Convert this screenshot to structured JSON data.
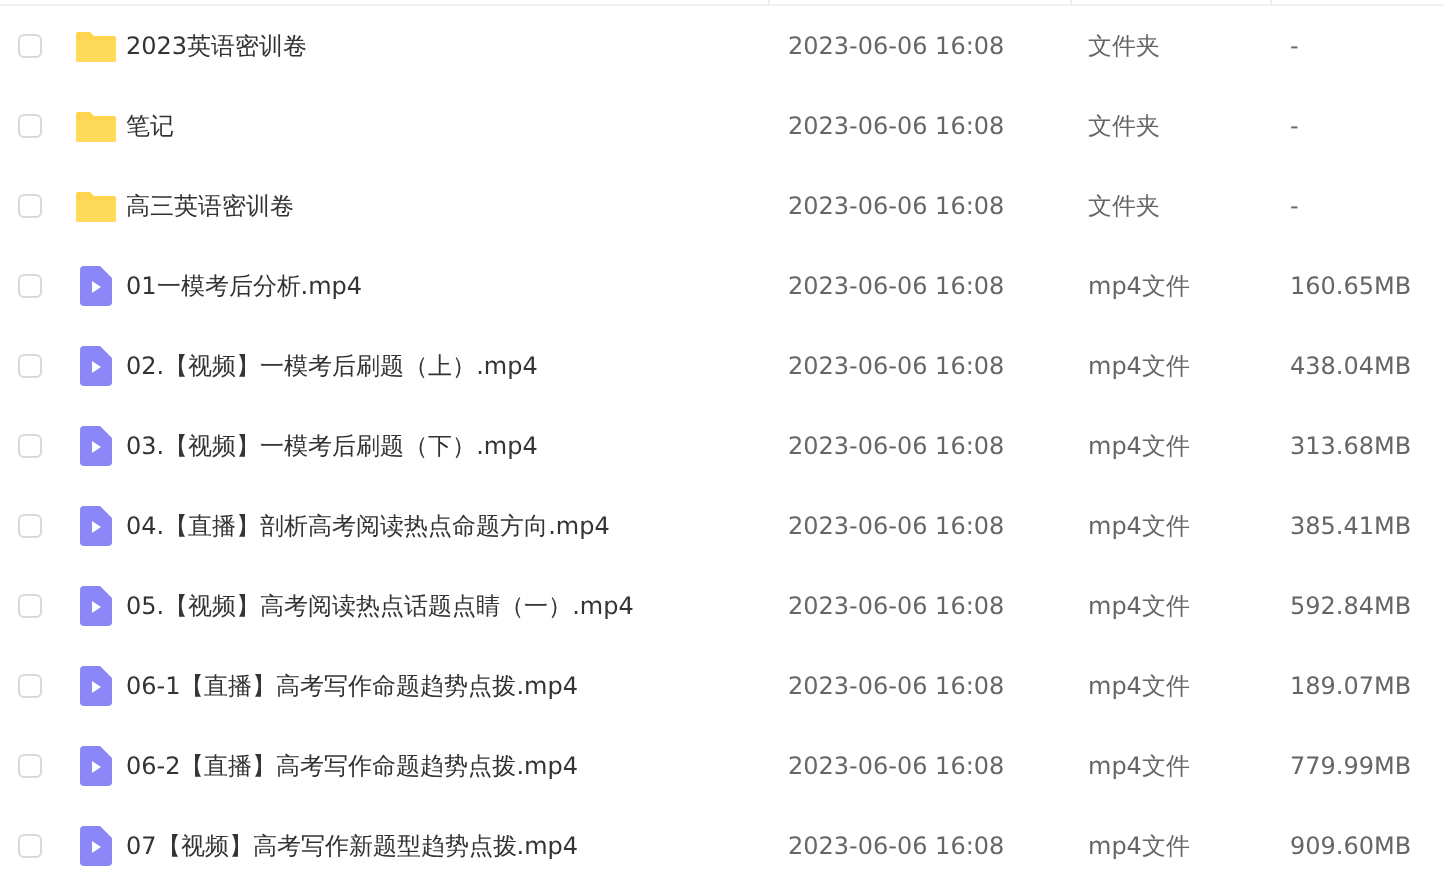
{
  "files": [
    {
      "kind": "folder",
      "name": "2023英语密训卷",
      "modified": "2023-06-06 16:08",
      "type": "文件夹",
      "size": "-",
      "checked": false
    },
    {
      "kind": "folder",
      "name": "笔记",
      "modified": "2023-06-06 16:08",
      "type": "文件夹",
      "size": "-",
      "checked": false
    },
    {
      "kind": "folder",
      "name": "高三英语密训卷",
      "modified": "2023-06-06 16:08",
      "type": "文件夹",
      "size": "-",
      "checked": false
    },
    {
      "kind": "video",
      "name": "01一模考后分析.mp4",
      "modified": "2023-06-06 16:08",
      "type": "mp4文件",
      "size": "160.65MB",
      "checked": false
    },
    {
      "kind": "video",
      "name": "02.【视频】一模考后刷题（上）.mp4",
      "modified": "2023-06-06 16:08",
      "type": "mp4文件",
      "size": "438.04MB",
      "checked": false
    },
    {
      "kind": "video",
      "name": "03.【视频】一模考后刷题（下）.mp4",
      "modified": "2023-06-06 16:08",
      "type": "mp4文件",
      "size": "313.68MB",
      "checked": false
    },
    {
      "kind": "video",
      "name": "04.【直播】剖析高考阅读热点命题方向.mp4",
      "modified": "2023-06-06 16:08",
      "type": "mp4文件",
      "size": "385.41MB",
      "checked": false
    },
    {
      "kind": "video",
      "name": "05.【视频】高考阅读热点话题点睛（一）.mp4",
      "modified": "2023-06-06 16:08",
      "type": "mp4文件",
      "size": "592.84MB",
      "checked": false
    },
    {
      "kind": "video",
      "name": "06-1【直播】高考写作命题趋势点拨.mp4",
      "modified": "2023-06-06 16:08",
      "type": "mp4文件",
      "size": "189.07MB",
      "checked": false
    },
    {
      "kind": "video",
      "name": "06-2【直播】高考写作命题趋势点拨.mp4",
      "modified": "2023-06-06 16:08",
      "type": "mp4文件",
      "size": "779.99MB",
      "checked": false
    },
    {
      "kind": "video",
      "name": "07【视频】高考写作新题型趋势点拨.mp4",
      "modified": "2023-06-06 16:08",
      "type": "mp4文件",
      "size": "909.60MB",
      "checked": false
    }
  ]
}
